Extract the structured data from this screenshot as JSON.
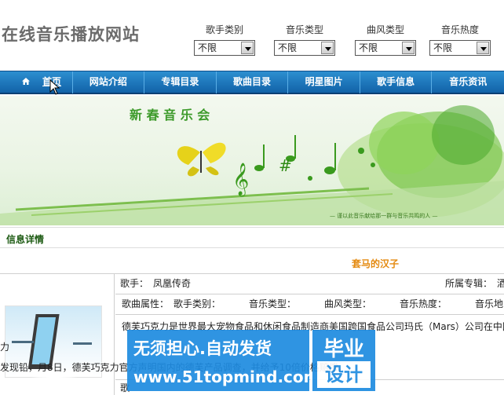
{
  "site": {
    "title": "在线音乐播放网站"
  },
  "filters": [
    {
      "label": "歌手类别",
      "value": "不限"
    },
    {
      "label": "音乐类型",
      "value": "不限"
    },
    {
      "label": "曲风类型",
      "value": "不限"
    },
    {
      "label": "音乐热度",
      "value": "不限"
    }
  ],
  "nav": {
    "items": [
      "首页",
      "网站介绍",
      "专辑目录",
      "歌曲目录",
      "明星图片",
      "歌手信息",
      "音乐资讯"
    ]
  },
  "banner": {
    "title": "新春音乐会",
    "caption": "— 谨以此音乐献给那一群与音乐共鸣的人 —"
  },
  "section": {
    "title": "信息详情"
  },
  "song": {
    "title": "套马的汉子",
    "singer_label": "歌手：",
    "singer": "凤凰传奇",
    "album_label": "所属专辑：",
    "album_value": "酒",
    "attr_label": "歌曲属性：",
    "attr_singer_type": "歌手类别：",
    "attr_music_type": "音乐类型：",
    "attr_style": "曲风类型：",
    "attr_heat": "音乐热度：",
    "attr_region": "音乐地",
    "desc_lines": [
      "德芙巧克力是世界最大宠物食品和休闲食品制造商美国跨国食品公司玛氏（Mars）公司在中国",
      "力",
      "发现铅，月8日，德芙巧克力官方声明国内的德芙产品调查，并给予10倍价格赔偿,"
    ],
    "bottom_label": "歌"
  },
  "watermark": {
    "line1": "无须担心.自动发货",
    "line2": "www.51topmind.com",
    "tag_top": "毕业",
    "tag_bottom": "设计"
  },
  "colors": {
    "nav": "#1262a8",
    "title_orange": "#e48a10",
    "section_green": "#1c5a12"
  }
}
